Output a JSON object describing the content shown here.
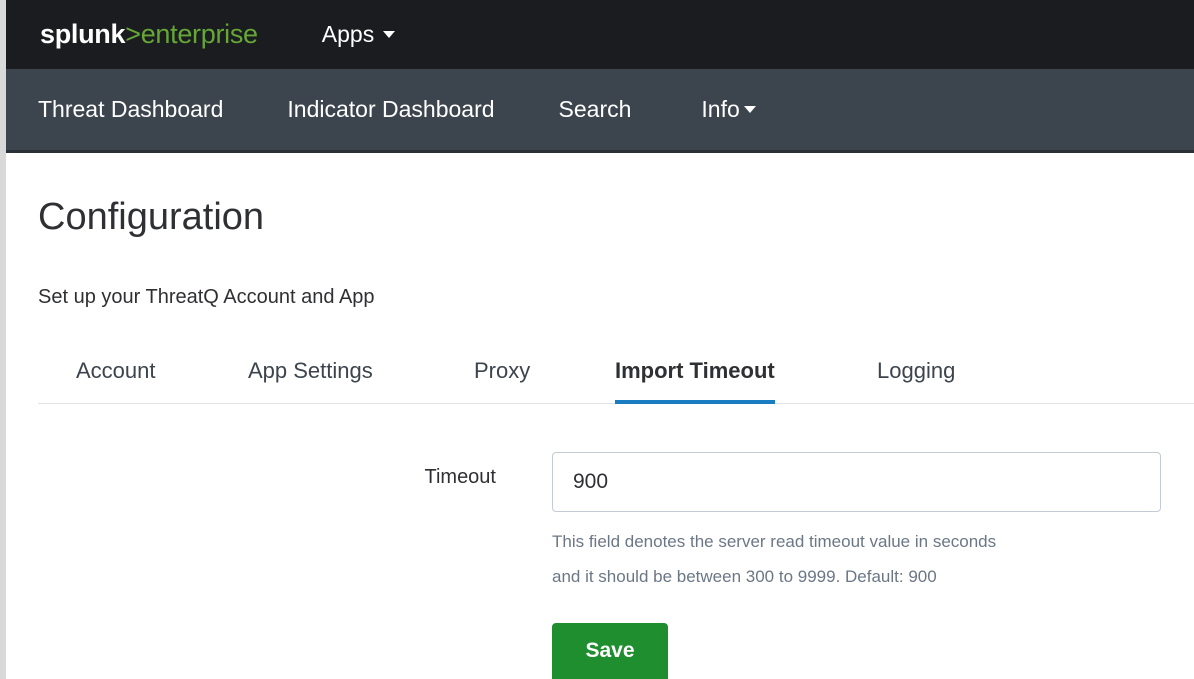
{
  "header": {
    "logo": {
      "brand": "splunk",
      "separator": ">",
      "product": "enterprise"
    },
    "apps_menu_label": "Apps"
  },
  "app_nav": {
    "items": [
      {
        "label": "Threat Dashboard"
      },
      {
        "label": "Indicator Dashboard"
      },
      {
        "label": "Search"
      },
      {
        "label": "Info"
      }
    ]
  },
  "page": {
    "title": "Configuration",
    "subtitle": "Set up your ThreatQ Account and App"
  },
  "tabs": [
    {
      "label": "Account",
      "active": false
    },
    {
      "label": "App Settings",
      "active": false
    },
    {
      "label": "Proxy",
      "active": false
    },
    {
      "label": "Import Timeout",
      "active": true
    },
    {
      "label": "Logging",
      "active": false
    }
  ],
  "form": {
    "timeout_label": "Timeout",
    "timeout_value": "900",
    "help_line1": "This field denotes the server read timeout value in seconds",
    "help_line2": "and it should be between 300 to 9999. Default: 900",
    "save_label": "Save"
  },
  "colors": {
    "topbar": "#1a1c20",
    "appbar": "#3c444d",
    "logo_accent": "#65a637",
    "active_tab_underline": "#1a7cc1",
    "save_button": "#1e8e2f"
  }
}
